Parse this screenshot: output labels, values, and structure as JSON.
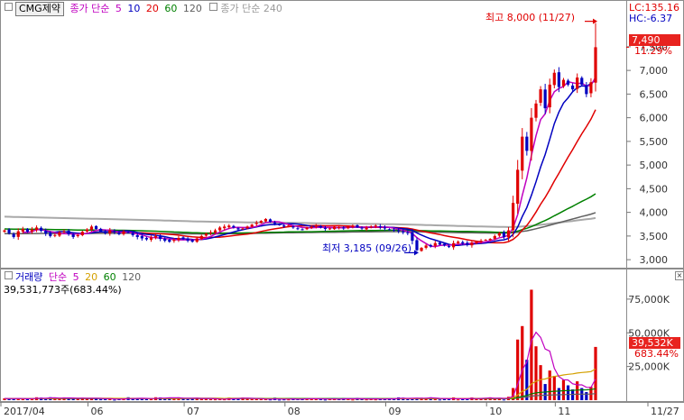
{
  "price_legend": {
    "title": "CMG제약",
    "ma_label": "종가 단순",
    "ma_periods": [
      "5",
      "10",
      "20",
      "60",
      "120"
    ],
    "ma_colors": [
      "#c000c0",
      "#0000c0",
      "#e00000",
      "#008000",
      "#606060"
    ],
    "ma240_label": "종가 단순 240",
    "ma240_color": "#9a9a9a"
  },
  "corner": {
    "lc": "LC:135.16",
    "hc": "HC:-6.37"
  },
  "price_tags": {
    "last_price": "7,490",
    "change_pct": "11.29%"
  },
  "annotations": {
    "high": "최고 8,000 (11/27)",
    "low": "최저 3,185 (09/26)"
  },
  "volume_legend": {
    "title": "거래량",
    "ma_label": "단순",
    "periods": [
      "5",
      "20",
      "60",
      "120"
    ],
    "period_colors": [
      "#c000c0",
      "#d4a000",
      "#008000",
      "#606060"
    ],
    "total": "39,531,773주(683.44%)"
  },
  "volume_tags": {
    "last_volume": "39,532K",
    "change_pct": "683.44%"
  },
  "chart_data": [
    {
      "type": "candlestick",
      "title": "CMG제약",
      "ylim": [
        2850,
        8450
      ],
      "yticks": [
        "3,000",
        "3,500",
        "4,000",
        "4,500",
        "5,000",
        "5,500",
        "6,000",
        "6,500",
        "7,000",
        "7,500"
      ],
      "x_labels": [
        "2017/04",
        "06",
        "07",
        "08",
        "09",
        "10",
        "11",
        "11/27"
      ],
      "close": [
        3620,
        3560,
        3480,
        3600,
        3650,
        3590,
        3640,
        3680,
        3610,
        3550,
        3500,
        3520,
        3580,
        3600,
        3540,
        3480,
        3520,
        3590,
        3640,
        3700,
        3650,
        3600,
        3560,
        3620,
        3580,
        3540,
        3600,
        3580,
        3520,
        3480,
        3450,
        3430,
        3470,
        3500,
        3440,
        3400,
        3380,
        3420,
        3460,
        3440,
        3400,
        3380,
        3450,
        3500,
        3550,
        3580,
        3620,
        3680,
        3700,
        3720,
        3680,
        3640,
        3660,
        3700,
        3740,
        3780,
        3820,
        3860,
        3800,
        3760,
        3740,
        3700,
        3720,
        3680,
        3660,
        3640,
        3680,
        3700,
        3720,
        3680,
        3650,
        3660,
        3700,
        3690,
        3660,
        3700,
        3720,
        3690,
        3660,
        3680,
        3700,
        3720,
        3690,
        3660,
        3640,
        3620,
        3600,
        3580,
        3560,
        3400,
        3200,
        3250,
        3300,
        3280,
        3350,
        3320,
        3300,
        3280,
        3350,
        3380,
        3340,
        3320,
        3360,
        3380,
        3400,
        3420,
        3440,
        3500,
        3560,
        3480,
        3620,
        4200,
        4900,
        5600,
        5300,
        6000,
        6300,
        6600,
        6200,
        6700,
        6950,
        6650,
        6800,
        6700,
        6600,
        6850,
        6700,
        6500,
        6750,
        7490
      ],
      "ma": {
        "5": "magenta line",
        "10": "navy line",
        "20": "red line",
        "60": "green line",
        "120": "grey line",
        "240": "light grey line"
      },
      "high": {
        "label": "최고 8,000 (11/27)",
        "value": 8000
      },
      "low": {
        "label": "최저 3,185 (09/26)",
        "value": 3185
      }
    },
    {
      "type": "bar",
      "title": "거래량",
      "ylim": [
        0,
        95000
      ],
      "yticks": [
        "25,000K",
        "50,000K",
        "75,000K"
      ],
      "last_value_k": 39532,
      "ma_periods": [
        "5",
        "20",
        "60",
        "120"
      ]
    }
  ]
}
